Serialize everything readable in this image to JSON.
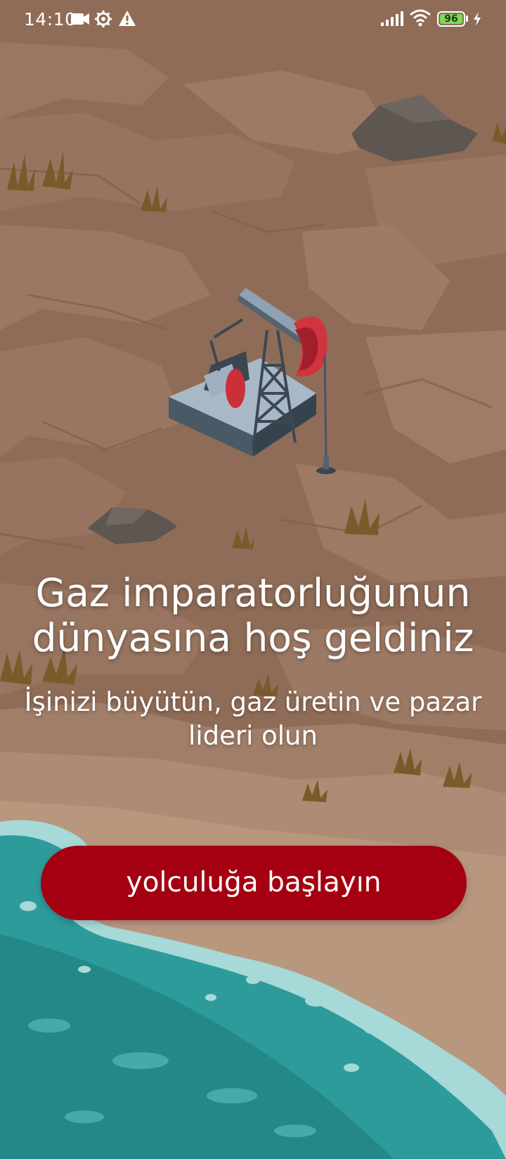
{
  "status_bar": {
    "time": "14:10",
    "battery_level": "96",
    "icons": [
      "video-camera-icon",
      "gear-icon",
      "warning-icon",
      "signal-icon",
      "wifi-icon",
      "battery-icon",
      "charging-icon"
    ]
  },
  "welcome": {
    "title": "Gaz imparatorluğunun dünyasına hoş geldiniz",
    "subtitle": "İşinizi büyütün, gaz üretin ve pazar lideri olun"
  },
  "actions": {
    "start_label": "yolculuğa başlayın"
  },
  "colors": {
    "ground": "#8d6a55",
    "sea": "#2e9b9b",
    "button": "#a50011",
    "text": "#ffffff"
  }
}
